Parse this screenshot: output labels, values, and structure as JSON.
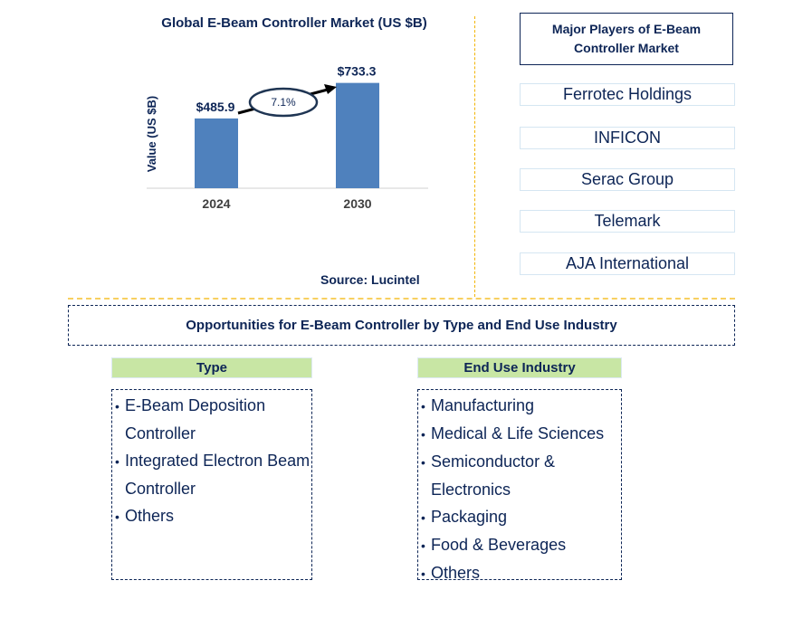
{
  "chart_data": {
    "type": "bar",
    "title": "Global E-Beam Controller Market (US $B)",
    "xlabel": "",
    "ylabel": "Value (US $B)",
    "categories": [
      "2024",
      "2030"
    ],
    "values": [
      485.9,
      733.3
    ],
    "data_labels": [
      "$485.9",
      "$733.3"
    ],
    "ylim": [
      0,
      800
    ],
    "grid": false,
    "bar_color": "#4f81bd",
    "annotation": {
      "type": "cagr-arrow",
      "label": "7.1%"
    }
  },
  "source": "Source: Lucintel",
  "players": {
    "title": "Major Players of E-Beam Controller Market",
    "items": [
      "Ferrotec Holdings",
      "INFICON",
      "Serac Group",
      "Telemark",
      "AJA International"
    ]
  },
  "opportunities": {
    "title": "Opportunities for E-Beam Controller by Type and End Use Industry",
    "type": {
      "heading": "Type",
      "items": [
        "E-Beam Deposition Controller",
        "Integrated Electron Beam Controller",
        "Others"
      ]
    },
    "end_use": {
      "heading": "End Use Industry",
      "items": [
        "Manufacturing",
        "Medical & Life Sciences",
        "Semiconductor & Electronics",
        "Packaging",
        "Food & Beverages",
        "Others"
      ]
    }
  },
  "colors": {
    "text": "#0d2556",
    "bar": "#4f81bd",
    "segment_header": "#c8e6a4",
    "divider": "#f2b400"
  }
}
